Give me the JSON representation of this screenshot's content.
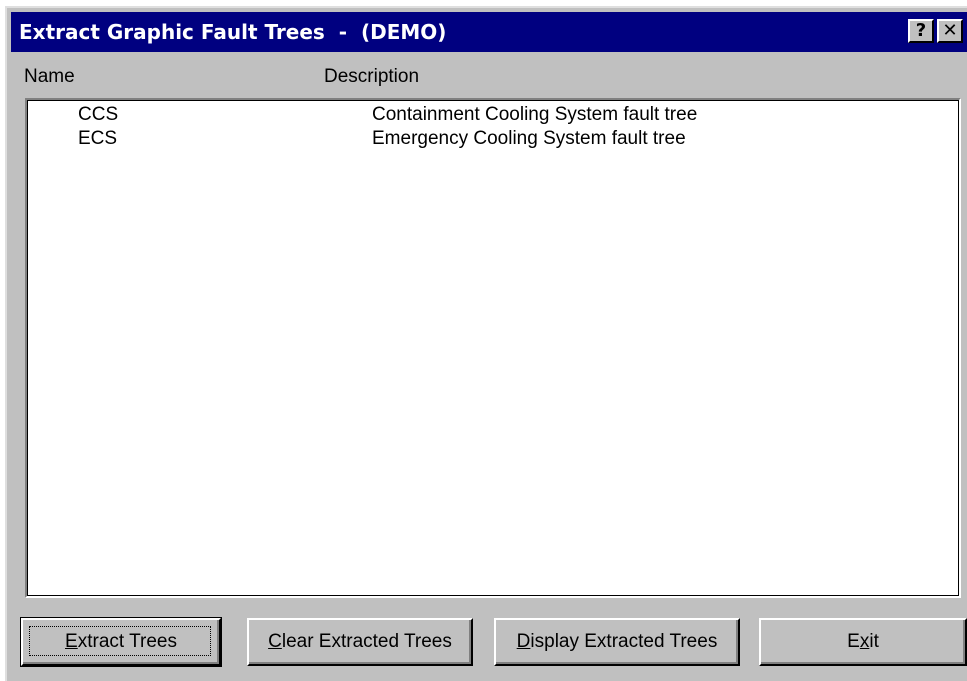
{
  "window": {
    "title": "Extract Graphic Fault Trees  -  (DEMO)",
    "help_button": "?",
    "close_button": "✕"
  },
  "columns": {
    "name": "Name",
    "description": "Description"
  },
  "trees": [
    {
      "name": "CCS",
      "description": "Containment Cooling System fault tree"
    },
    {
      "name": "ECS",
      "description": "Emergency Cooling System fault tree"
    }
  ],
  "buttons": {
    "extract": {
      "label": "Extract Trees",
      "accelerator": "E"
    },
    "clear": {
      "label": "Clear Extracted Trees",
      "accelerator": "C"
    },
    "display": {
      "label": "Display Extracted Trees",
      "accelerator": "D"
    },
    "exit": {
      "label": "Exit",
      "accelerator": "x"
    }
  },
  "colors": {
    "titlebar": "#000080",
    "face": "#c0c0c0"
  }
}
